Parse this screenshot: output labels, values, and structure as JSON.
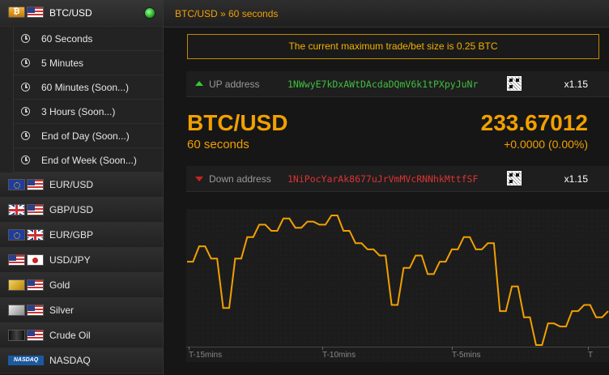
{
  "sidebar": {
    "active_asset": {
      "label": "BTC/USD",
      "status": "online"
    },
    "periods": [
      {
        "label": "60 Seconds"
      },
      {
        "label": "5 Minutes"
      },
      {
        "label": "60 Minutes (Soon...)"
      },
      {
        "label": "3 Hours (Soon...)"
      },
      {
        "label": "End of Day (Soon...)"
      },
      {
        "label": "End of Week (Soon...)"
      }
    ],
    "assets": [
      {
        "label": "EUR/USD",
        "flags": [
          "eu-flag-icon",
          "us-flag-icon"
        ]
      },
      {
        "label": "GBP/USD",
        "flags": [
          "gb-flag-icon",
          "us-flag-icon"
        ]
      },
      {
        "label": "EUR/GBP",
        "flags": [
          "eu-flag-icon",
          "gb-flag-icon"
        ]
      },
      {
        "label": "USD/JPY",
        "flags": [
          "us-flag-icon",
          "jp-flag-icon"
        ]
      },
      {
        "label": "Gold",
        "flags": [
          "gold-bar-icon",
          "us-flag-icon"
        ]
      },
      {
        "label": "Silver",
        "flags": [
          "silver-bar-icon",
          "us-flag-icon"
        ]
      },
      {
        "label": "Crude Oil",
        "flags": [
          "oil-barrel-icon",
          "us-flag-icon"
        ]
      },
      {
        "label": "NASDAQ",
        "flags": [
          "nasdaq-logo-icon"
        ],
        "logo_text": "NASDAQ"
      }
    ]
  },
  "header": {
    "breadcrumb": "BTC/USD » 60 seconds"
  },
  "notice": {
    "text": "The current maximum trade/bet size is 0.25 BTC"
  },
  "up_address": {
    "label": "UP address",
    "hash": "1NWwyE7kDxAWtDAcdaDQmV6k1tPXpyJuNr",
    "multiplier": "x1.15"
  },
  "down_address": {
    "label": "Down address",
    "hash": "1NiPocYarAk8677uJrVmMVcRNNhkMttfSF",
    "multiplier": "x1.15"
  },
  "quote": {
    "pair": "BTC/USD",
    "period": "60 seconds",
    "price": "233.67012",
    "change": "+0.0000 (0.00%)"
  },
  "colors": {
    "accent": "#f2a000",
    "up": "#3fbf3f",
    "down": "#d33333",
    "line": "#f2a000"
  },
  "chart_data": {
    "type": "line",
    "x_ticks": [
      "T-15mins",
      "T-10mins",
      "T-5mins",
      "T"
    ],
    "series": [
      {
        "values": [
          233.62,
          233.62,
          233.67,
          233.67,
          233.63,
          233.63,
          233.47,
          233.47,
          233.63,
          233.63,
          233.7,
          233.7,
          233.74,
          233.74,
          233.72,
          233.72,
          233.76,
          233.76,
          233.73,
          233.73,
          233.75,
          233.75,
          233.74,
          233.74,
          233.77,
          233.77,
          233.72,
          233.72,
          233.68,
          233.68,
          233.66,
          233.66,
          233.64,
          233.64,
          233.48,
          233.48,
          233.6,
          233.6,
          233.64,
          233.64,
          233.58,
          233.58,
          233.62,
          233.62,
          233.66,
          233.66,
          233.7,
          233.7,
          233.66,
          233.66,
          233.68,
          233.68,
          233.46,
          233.46,
          233.54,
          233.54,
          233.44,
          233.44,
          233.35,
          233.35,
          233.42,
          233.42,
          233.41,
          233.41,
          233.46,
          233.46,
          233.48,
          233.48,
          233.44,
          233.44,
          233.46
        ]
      }
    ]
  }
}
